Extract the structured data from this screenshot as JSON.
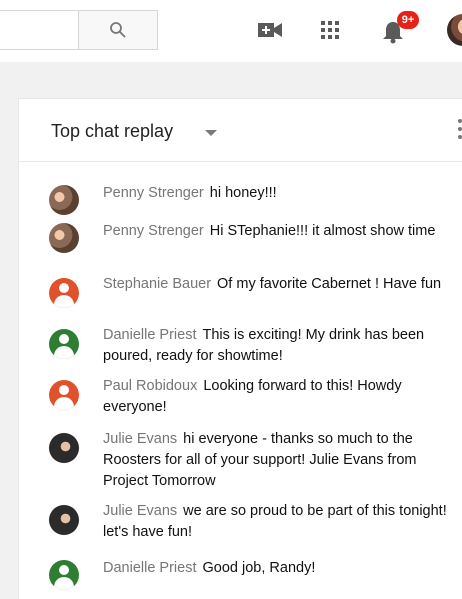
{
  "topbar": {
    "search_icon": "search-icon",
    "upload_icon": "video-camera-plus-icon",
    "apps_icon": "apps-grid-icon",
    "notifications_icon": "bell-icon",
    "notification_badge": "9+"
  },
  "chat": {
    "title": "Top chat replay",
    "messages": [
      {
        "author": "Penny Strenger",
        "text": "hi honey!!!",
        "avatar": "photo",
        "avatar_color": "#8a6a56"
      },
      {
        "author": "Penny Strenger",
        "text": "Hi STephanie!!! it almost show time",
        "avatar": "photo",
        "avatar_color": "#8a6a56"
      },
      {
        "author": "Stephanie Bauer",
        "text": "Of my favorite Cabernet ! Have fun",
        "avatar": "default",
        "avatar_color": "#e0522c"
      },
      {
        "author": "Danielle Priest",
        "text": "This is exciting! My drink has been poured, ready for showtime!",
        "avatar": "default",
        "avatar_color": "#2e7d32"
      },
      {
        "author": "Paul Robidoux",
        "text": "Looking forward to this! Howdy everyone!",
        "avatar": "default",
        "avatar_color": "#e0522c"
      },
      {
        "author": "Julie Evans",
        "text": "hi everyone - thanks so much to the Roosters for all of your support! Julie Evans from Project Tomorrow",
        "avatar": "photo",
        "avatar_color": "#2b2b2b"
      },
      {
        "author": "Julie Evans",
        "text": "we are so proud to be part of this tonight! let's have fun!",
        "avatar": "photo",
        "avatar_color": "#2b2b2b"
      },
      {
        "author": "Danielle Priest",
        "text": "Good job, Randy!",
        "avatar": "default",
        "avatar_color": "#2e7d32"
      }
    ]
  }
}
